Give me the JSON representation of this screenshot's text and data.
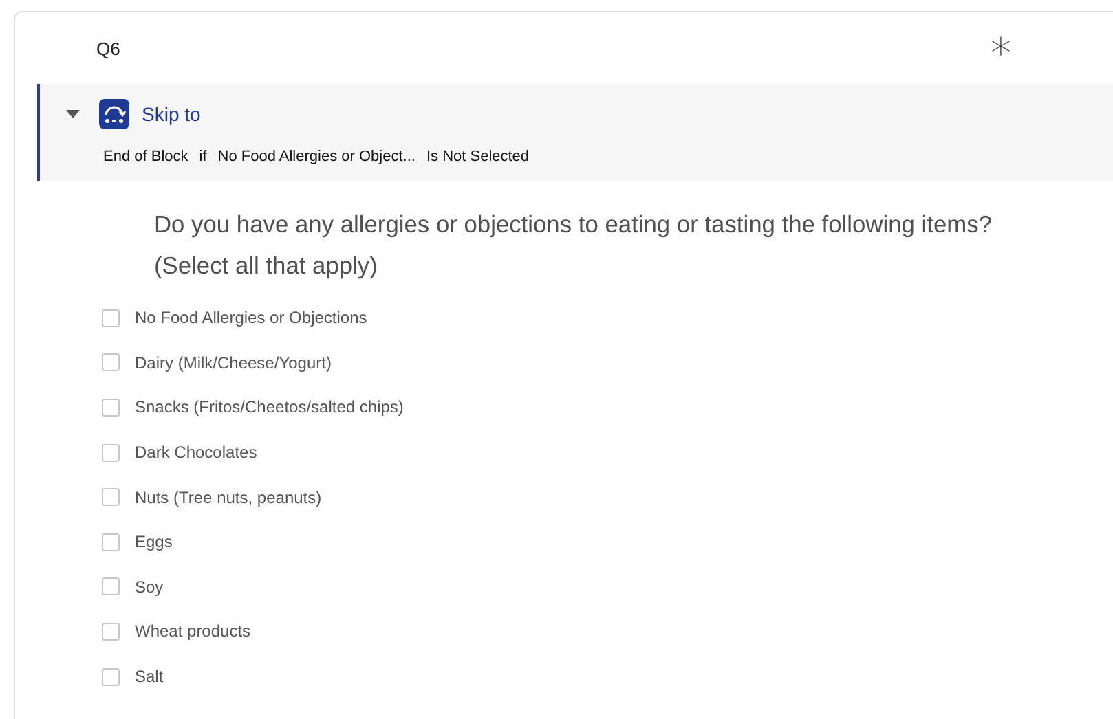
{
  "question": {
    "number": "Q6",
    "required_mark": "*"
  },
  "skip_logic": {
    "expanded": true,
    "label": "Skip to",
    "destination": "End of Block",
    "connector": "if",
    "choice": "No Food Allergies or Object...",
    "condition": "Is Not Selected"
  },
  "question_text": "Do you have any allergies or objections to eating or tasting the following items? (Select all that apply)",
  "choices": [
    {
      "label": "No Food Allergies or Objections",
      "checked": false
    },
    {
      "label": "Dairy (Milk/Cheese/Yogurt)",
      "checked": false
    },
    {
      "label": "Snacks (Fritos/Cheetos/salted chips)",
      "checked": false
    },
    {
      "label": "Dark Chocolates",
      "checked": false
    },
    {
      "label": "Nuts (Tree nuts, peanuts)",
      "checked": false
    },
    {
      "label": "Eggs",
      "checked": false
    },
    {
      "label": "Soy",
      "checked": false
    },
    {
      "label": "Wheat products",
      "checked": false
    },
    {
      "label": "Salt",
      "checked": false
    }
  ]
}
